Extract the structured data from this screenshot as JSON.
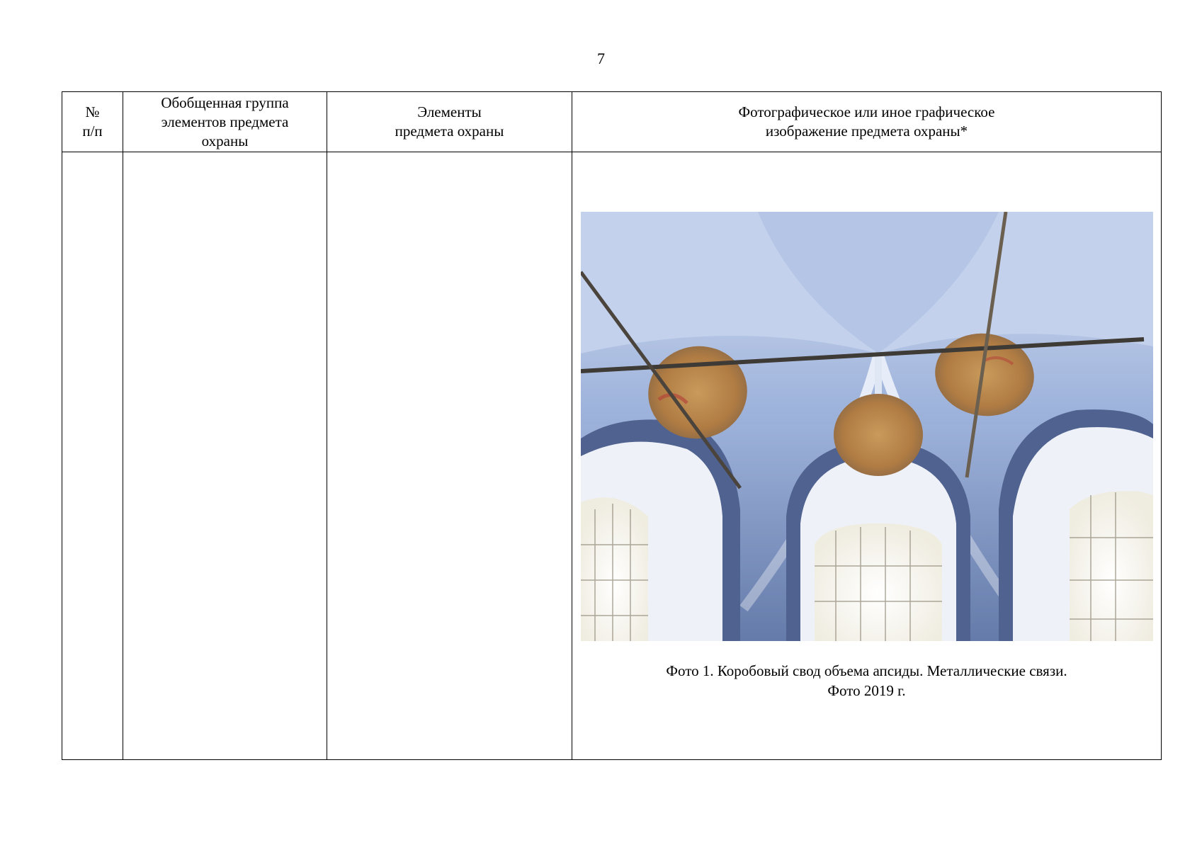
{
  "page": {
    "number": "7"
  },
  "table": {
    "headers": {
      "col1": [
        "№",
        "п/п"
      ],
      "col2": [
        "Обобщенная группа",
        "элементов предмета",
        "охраны"
      ],
      "col3": [
        "Элементы",
        "предмета охраны"
      ],
      "col4": [
        "Фотографическое или иное графическое",
        "изображение предмета охраны*"
      ]
    },
    "row": {
      "number": "",
      "group": "",
      "elements": "",
      "photo_caption": [
        "Фото 1. Коробовый свод объема апсиды. Металлические связи.",
        "Фото 2019 г."
      ]
    }
  },
  "colors": {
    "border": "#000000",
    "vault_blue": "#7f97c4",
    "vault_light": "#c9d6ee",
    "window_light": "#fbfaf4",
    "fresco": "#b8864c",
    "tie_rod": "#3e3a36"
  }
}
